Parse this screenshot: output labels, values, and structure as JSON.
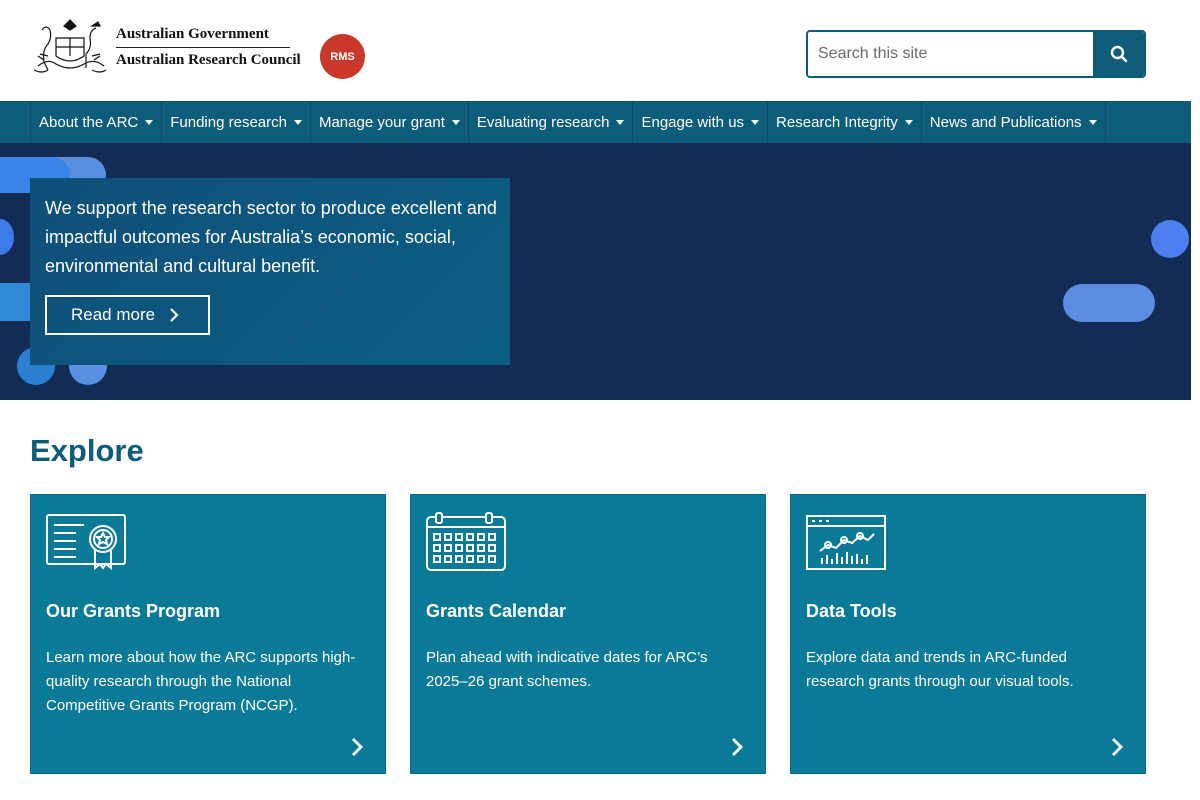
{
  "header": {
    "gov_line1": "Australian Government",
    "gov_line2": "Australian Research Council",
    "rms_badge": "RMS",
    "search_placeholder": "Search this site"
  },
  "nav": {
    "items": [
      {
        "label": "About the ARC"
      },
      {
        "label": "Funding research"
      },
      {
        "label": "Manage your grant"
      },
      {
        "label": "Evaluating research"
      },
      {
        "label": "Engage with us"
      },
      {
        "label": "Research Integrity"
      },
      {
        "label": "News and Publications"
      }
    ]
  },
  "hero": {
    "text": "We support the research sector to produce excellent and impactful outcomes for Australia’s economic, social, environmental and cultural benefit.",
    "button_label": "Read more"
  },
  "explore": {
    "title": "Explore",
    "cards": [
      {
        "icon": "certificate-icon",
        "title": "Our Grants Program",
        "description": "Learn more about how the ARC supports high-quality research through the National Competitive Grants Program (NCGP)."
      },
      {
        "icon": "calendar-icon",
        "title": "Grants Calendar",
        "description": "Plan ahead with indicative dates for ARC’s 2025–26 grant schemes."
      },
      {
        "icon": "data-chart-icon",
        "title": "Data Tools",
        "description": "Explore data and trends in ARC-funded research grants through our visual tools."
      }
    ]
  },
  "colors": {
    "nav_bg": "#0d5c79",
    "hero_bg": "#122c55",
    "card_bg": "#0b7a96",
    "rms_badge": "#c8392b",
    "title_color": "#0d5c79"
  }
}
